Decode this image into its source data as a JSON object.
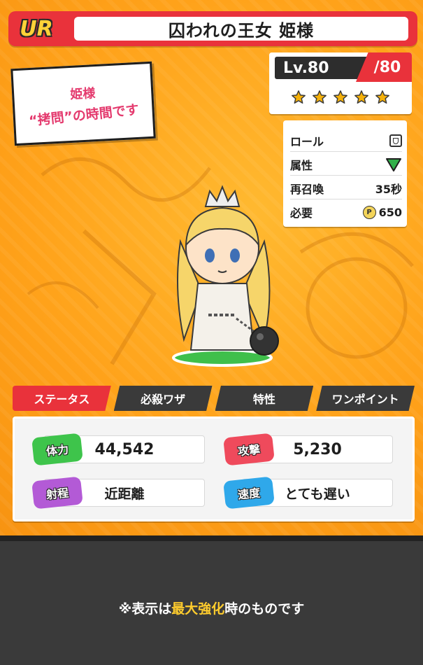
{
  "header": {
    "rarity": "UR",
    "title": "囚われの王女 姫様"
  },
  "logo": {
    "line1": "姫様",
    "line2": "“拷問”の時間です"
  },
  "level": {
    "current": "Lv.80",
    "max": "/80",
    "stars": 5
  },
  "info": {
    "role_label": "ロール",
    "role_icon": "shield-icon",
    "attribute_label": "属性",
    "attribute_icon": "green-down-triangle-icon",
    "resummon_label": "再召喚",
    "resummon_value": "35秒",
    "cost_label": "必要",
    "cost_icon": "p-coin-icon",
    "cost_value": "650"
  },
  "tabs": [
    "ステータス",
    "必殺ワザ",
    "特性",
    "ワンポイント"
  ],
  "active_tab": 0,
  "stats": {
    "hp_label": "体力",
    "hp_value": "44,542",
    "attack_label": "攻撃",
    "attack_value": "5,230",
    "range_label": "射程",
    "range_value": "近距離",
    "speed_label": "速度",
    "speed_value": "とても遅い"
  },
  "note": {
    "prefix": "※表示は",
    "highlight": "最大強化",
    "suffix": "時のものです"
  },
  "colors": {
    "accent_red": "#e9323b",
    "background_orange": "#ffa21a",
    "star_gold": "#f5b10b",
    "highlight_yellow": "#ffcc2d"
  }
}
